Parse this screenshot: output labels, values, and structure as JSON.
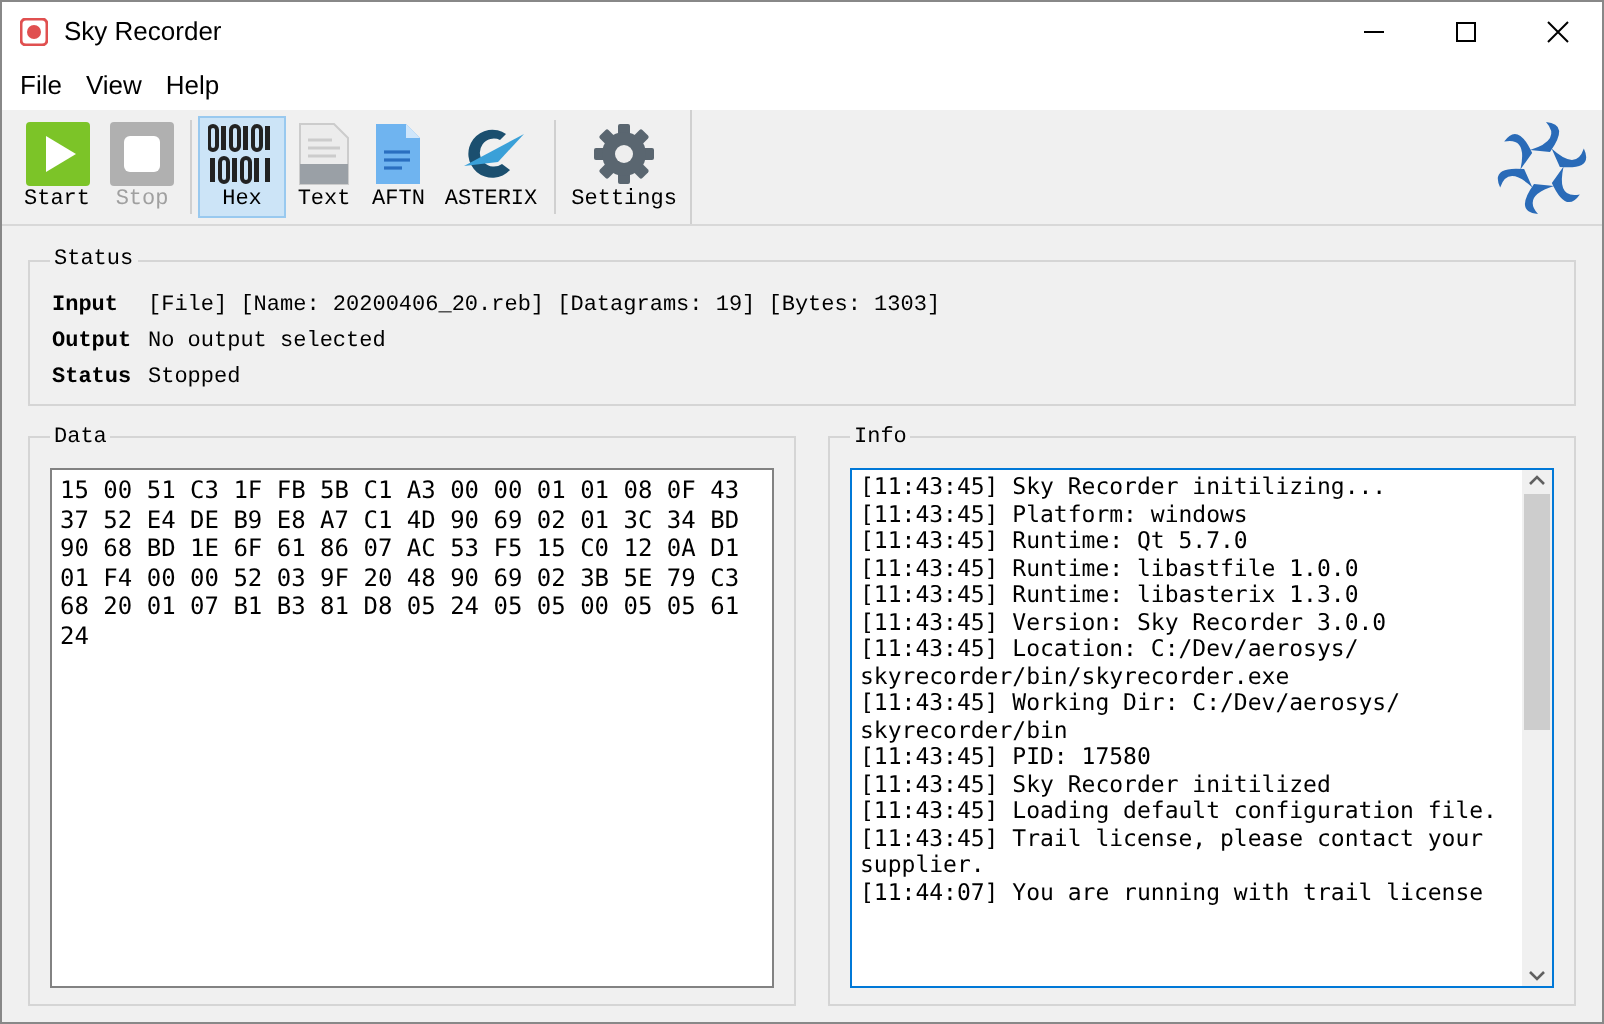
{
  "window": {
    "title": "Sky Recorder"
  },
  "menu": [
    "File",
    "View",
    "Help"
  ],
  "toolbar": [
    {
      "kind": "start",
      "label": "Start",
      "disabled": false,
      "selected": false
    },
    {
      "kind": "stop",
      "label": "Stop",
      "disabled": true,
      "selected": false
    },
    {
      "kind": "hex",
      "label": "Hex",
      "disabled": false,
      "selected": true
    },
    {
      "kind": "text",
      "label": "Text",
      "disabled": false,
      "selected": false
    },
    {
      "kind": "aftn",
      "label": "AFTN",
      "disabled": false,
      "selected": false
    },
    {
      "kind": "asterix",
      "label": "ASTERIX",
      "disabled": false,
      "selected": false
    },
    {
      "kind": "settings",
      "label": "Settings",
      "disabled": false,
      "selected": false
    }
  ],
  "status": {
    "title": "Status",
    "rows": [
      {
        "label": "Input",
        "value": "[File] [Name: 20200406_20.reb] [Datagrams: 19] [Bytes: 1303]"
      },
      {
        "label": "Output",
        "value": "No output selected"
      },
      {
        "label": "Status",
        "value": "Stopped"
      }
    ]
  },
  "data": {
    "title": "Data",
    "lines": [
      "15 00 51 C3 1F FB 5B C1 A3 00 00 01 01 08 0F 43",
      "37 52 E4 DE B9 E8 A7 C1 4D 90 69 02 01 3C 34 BD",
      "90 68 BD 1E 6F 61 86 07 AC 53 F5 15 C0 12 0A D1",
      "01 F4 00 00 52 03 9F 20 48 90 69 02 3B 5E 79 C3",
      "68 20 01 07 B1 B3 81 D8 05 24 05 05 00 05 05 61",
      "24"
    ]
  },
  "info": {
    "title": "Info",
    "log": [
      "[11:43:45] Sky Recorder initilizing...",
      "[11:43:45] Platform: windows",
      "[11:43:45] Runtime: Qt 5.7.0",
      "[11:43:45] Runtime: libastfile 1.0.0",
      "[11:43:45] Runtime: libasterix 1.3.0",
      "[11:43:45] Version: Sky Recorder 3.0.0",
      "[11:43:45] Location: C:/Dev/aerosys/",
      "skyrecorder/bin/skyrecorder.exe",
      "[11:43:45] Working Dir: C:/Dev/aerosys/",
      "skyrecorder/bin",
      "[11:43:45] PID: 17580",
      "[11:43:45] Sky Recorder initilized",
      "[11:43:45] Loading default configuration file.",
      "[11:43:45] Trail license, please contact your",
      "supplier.",
      "[11:44:07] You are running with trail license"
    ]
  }
}
